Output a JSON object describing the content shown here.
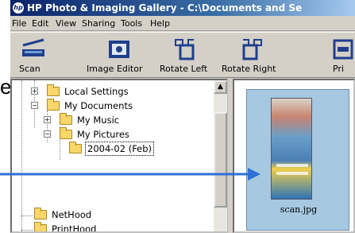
{
  "window": {
    "title": "HP Photo & Imaging Gallery - C:\\Documents and Se"
  },
  "menu": [
    "File",
    "Edit",
    "View",
    "Sharing",
    "Tools",
    "Help"
  ],
  "toolbar": {
    "scan": "Scan",
    "image_editor": "Image Editor",
    "rotate_left": "Rotate Left",
    "rotate_right": "Rotate Right",
    "print": "Pri"
  },
  "tree": {
    "local_settings": "Local Settings",
    "my_documents": "My Documents",
    "my_music": "My Music",
    "my_pictures": "My Pictures",
    "folder_2004_02": "2004-02 (Feb)",
    "nethood": "NetHood",
    "printhood": "PrintHood"
  },
  "content": {
    "file_name": "scan.jpg"
  },
  "outside_label": "e",
  "colors": {
    "titlebar_start": "#0a246a",
    "arrow": "#2f6fd6",
    "tile": "#a6c8e0",
    "folder": "#f7d66a"
  }
}
